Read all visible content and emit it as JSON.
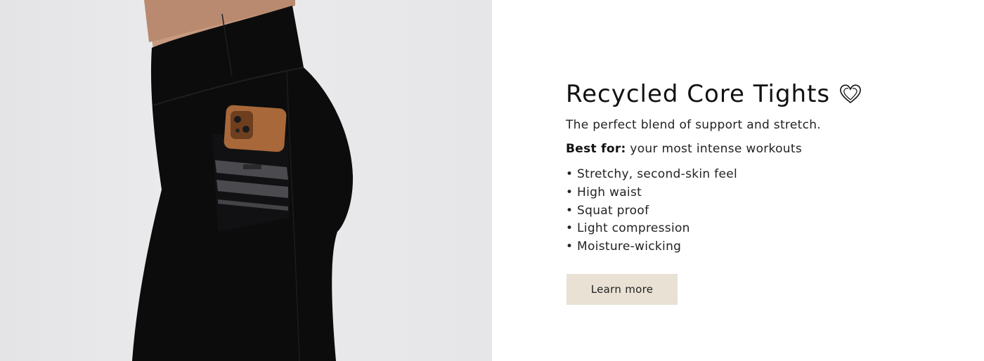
{
  "hero": {
    "image": "product-photo-leggings-with-phone-pocket"
  },
  "product": {
    "title": "Recycled Core Tights",
    "title_icon": "heart-icon",
    "subtitle": "The perfect blend of support and stretch.",
    "best_for_label": "Best for:",
    "best_for_value": "your most intense workouts",
    "features": [
      "Stretchy, second-skin feel",
      "High waist",
      "Squat proof",
      "Light compression",
      "Moisture-wicking"
    ],
    "cta_label": "Learn more"
  },
  "colors": {
    "cta_background": "#e8e1d4",
    "text": "#111111",
    "hero_background": "#e6e6e8"
  }
}
